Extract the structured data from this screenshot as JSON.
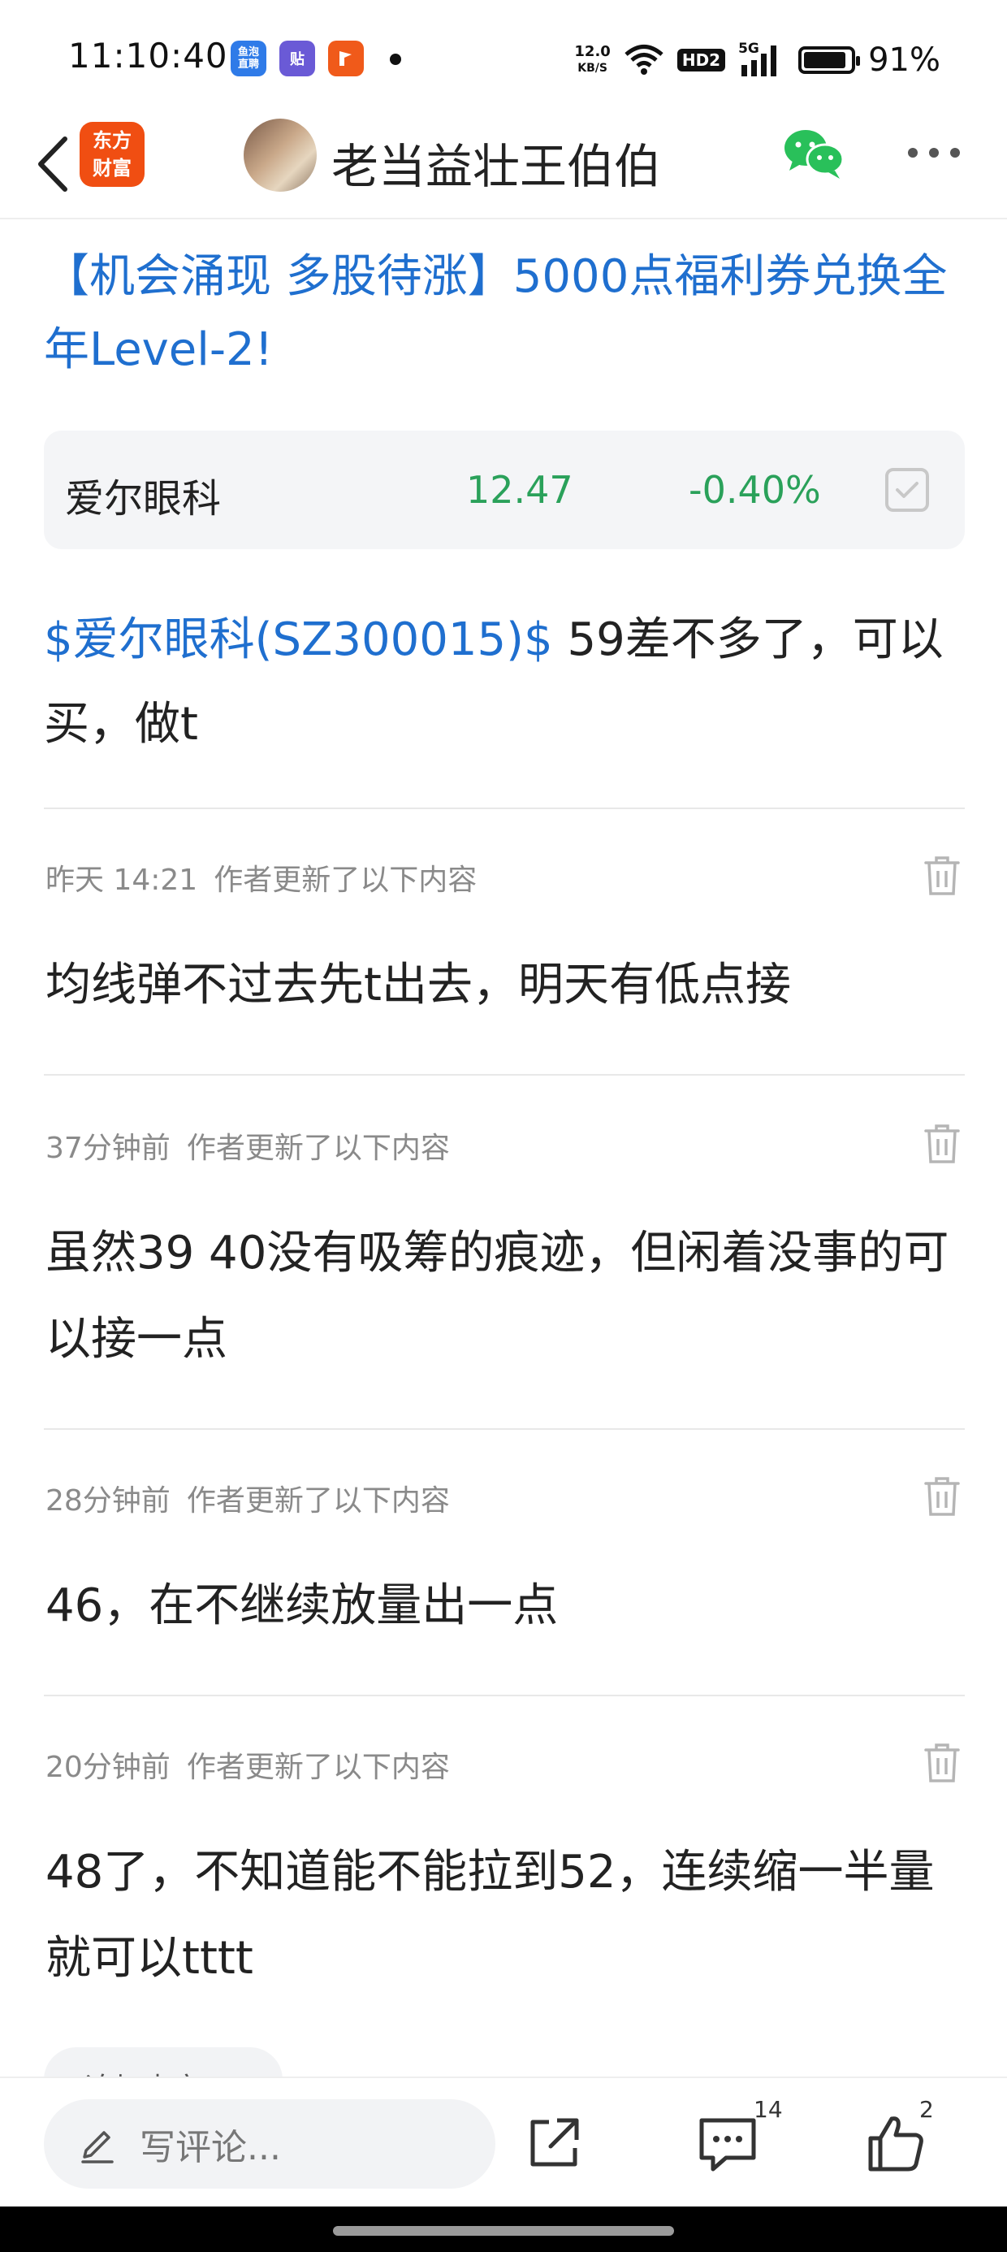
{
  "status_bar": {
    "time": "11:10:40",
    "app_icons": [
      {
        "name": "鱼泡直聘",
        "color": "#2f7be8"
      },
      {
        "name": "贴",
        "color": "#6a5ad6"
      },
      {
        "name": "flag-app",
        "color": "#f05a1a"
      }
    ],
    "net_speed_value": "12.0",
    "net_speed_unit": "KB/S",
    "hd_label": "HD2",
    "signal_label": "5G",
    "battery_level": 0.91,
    "battery_percent": "91%"
  },
  "header": {
    "logo_line1": "东方",
    "logo_line2": "财富",
    "author_name": "老当益壮王伯伯",
    "logo_color": "#f04e12",
    "wechat_color": "#29c05a"
  },
  "promo": {
    "text": "【机会涌现 多股待涨】5000点福利券兑换全年Level-2!"
  },
  "stock_card": {
    "name": "爱尔眼科",
    "price": "12.47",
    "change": "-0.40%",
    "down_color": "#2aa15a"
  },
  "main_post": {
    "stock_link": "$爱尔眼科(SZ300015)$",
    "text": " 59差不多了，可以买，做t"
  },
  "updates": [
    {
      "time": "昨天 14:21",
      "label": "作者更新了以下内容",
      "text": "均线弹不过去先t出去，明天有低点接"
    },
    {
      "time": "37分钟前",
      "label": "作者更新了以下内容",
      "text": "虽然39 40没有吸筹的痕迹，但闲着没事的可以接一点"
    },
    {
      "time": "28分钟前",
      "label": "作者更新了以下内容",
      "text": "46，在不继续放量出一点"
    },
    {
      "time": "20分钟前",
      "label": "作者更新了以下内容",
      "text": "48了，不知道能不能拉到52，连续缩一半量就可以tttt"
    }
  ],
  "more_pill": {
    "label": "追加内容"
  },
  "bottom_bar": {
    "comment_placeholder": "写评论...",
    "comment_count": "14",
    "like_count": "2"
  }
}
